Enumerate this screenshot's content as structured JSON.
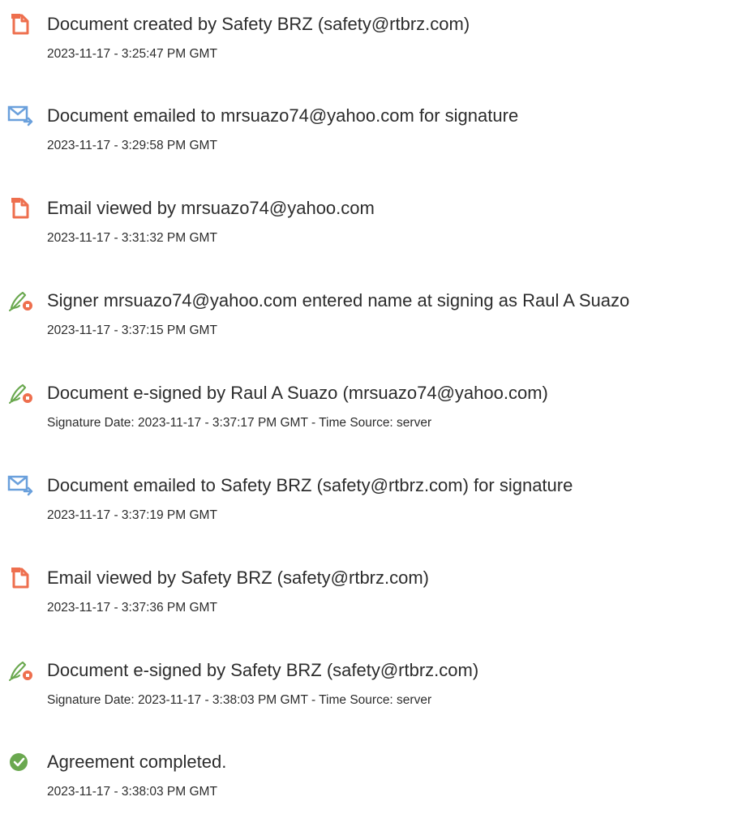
{
  "colors": {
    "doc_icon": "#ee6f4e",
    "email_icon": "#6aa0dc",
    "sign_icon_pen": "#6aa84f",
    "check_icon": "#6aa84f",
    "text": "#2c2c2c"
  },
  "events": [
    {
      "icon": "document-icon",
      "title": "Document created by Safety BRZ (safety@rtbrz.com)",
      "detail": "2023-11-17 - 3:25:47 PM GMT"
    },
    {
      "icon": "email-icon",
      "title": "Document emailed to mrsuazo74@yahoo.com for signature",
      "detail": "2023-11-17 - 3:29:58 PM GMT"
    },
    {
      "icon": "document-icon",
      "title": "Email viewed by mrsuazo74@yahoo.com",
      "detail": "2023-11-17 - 3:31:32 PM GMT"
    },
    {
      "icon": "e-sign-icon",
      "title": "Signer mrsuazo74@yahoo.com entered name at signing as Raul A Suazo",
      "detail": "2023-11-17 - 3:37:15 PM GMT"
    },
    {
      "icon": "e-sign-icon",
      "title": "Document e-signed by Raul A Suazo (mrsuazo74@yahoo.com)",
      "detail": "Signature Date: 2023-11-17 - 3:37:17 PM GMT - Time Source: server"
    },
    {
      "icon": "email-icon",
      "title": "Document emailed to Safety BRZ (safety@rtbrz.com) for signature",
      "detail": "2023-11-17 - 3:37:19 PM GMT"
    },
    {
      "icon": "document-icon",
      "title": "Email viewed by Safety BRZ (safety@rtbrz.com)",
      "detail": "2023-11-17 - 3:37:36 PM GMT"
    },
    {
      "icon": "e-sign-icon",
      "title": "Document e-signed by Safety BRZ (safety@rtbrz.com)",
      "detail": "Signature Date: 2023-11-17 - 3:38:03 PM GMT - Time Source: server"
    },
    {
      "icon": "check-circle-icon",
      "title": "Agreement completed.",
      "detail": "2023-11-17 - 3:38:03 PM GMT"
    }
  ]
}
